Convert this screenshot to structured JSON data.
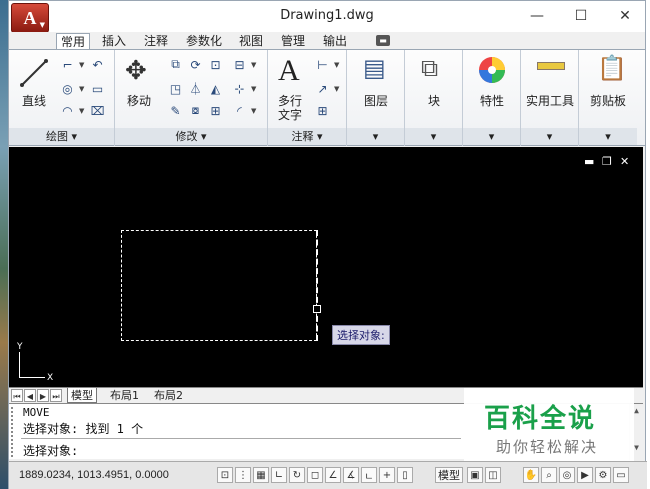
{
  "window": {
    "title": "Drawing1.dwg",
    "app_letter": "A",
    "controls": {
      "minimize": "—",
      "maximize": "☐",
      "close": "✕"
    }
  },
  "tabs": [
    "常用",
    "插入",
    "注释",
    "参数化",
    "视图",
    "管理",
    "输出"
  ],
  "ribbon": {
    "draw_panel": {
      "title": "绘图 ▾",
      "big_button": "直线"
    },
    "modify_panel": {
      "title": "修改 ▾",
      "big_button": "移动"
    },
    "annotation_panel": {
      "title": "注释 ▾",
      "big_button_line1": "多行",
      "big_button_line2": "文字"
    },
    "layers_panel": {
      "label": "图层"
    },
    "block_panel": {
      "label": "块"
    },
    "properties_panel": {
      "label": "特性"
    },
    "utilities_panel": {
      "label": "实用工具"
    },
    "clipboard_panel": {
      "label": "剪贴板"
    }
  },
  "drawing": {
    "prompt": "选择对象:",
    "ucs_y": "Y",
    "ucs_x": "X",
    "viewport_controls": [
      "▬",
      "❐",
      "✕"
    ]
  },
  "layout_tabs": [
    "模型",
    "布局1",
    "布局2"
  ],
  "command": {
    "line1": "MOVE",
    "line2": "选择对象: 找到 1 个",
    "line3": "选择对象:"
  },
  "watermark": {
    "title": "百科全说",
    "subtitle": "助你轻松解决"
  },
  "status": {
    "coordinates": "1889.0234, 1013.4951, 0.0000",
    "model_label": "模型"
  }
}
